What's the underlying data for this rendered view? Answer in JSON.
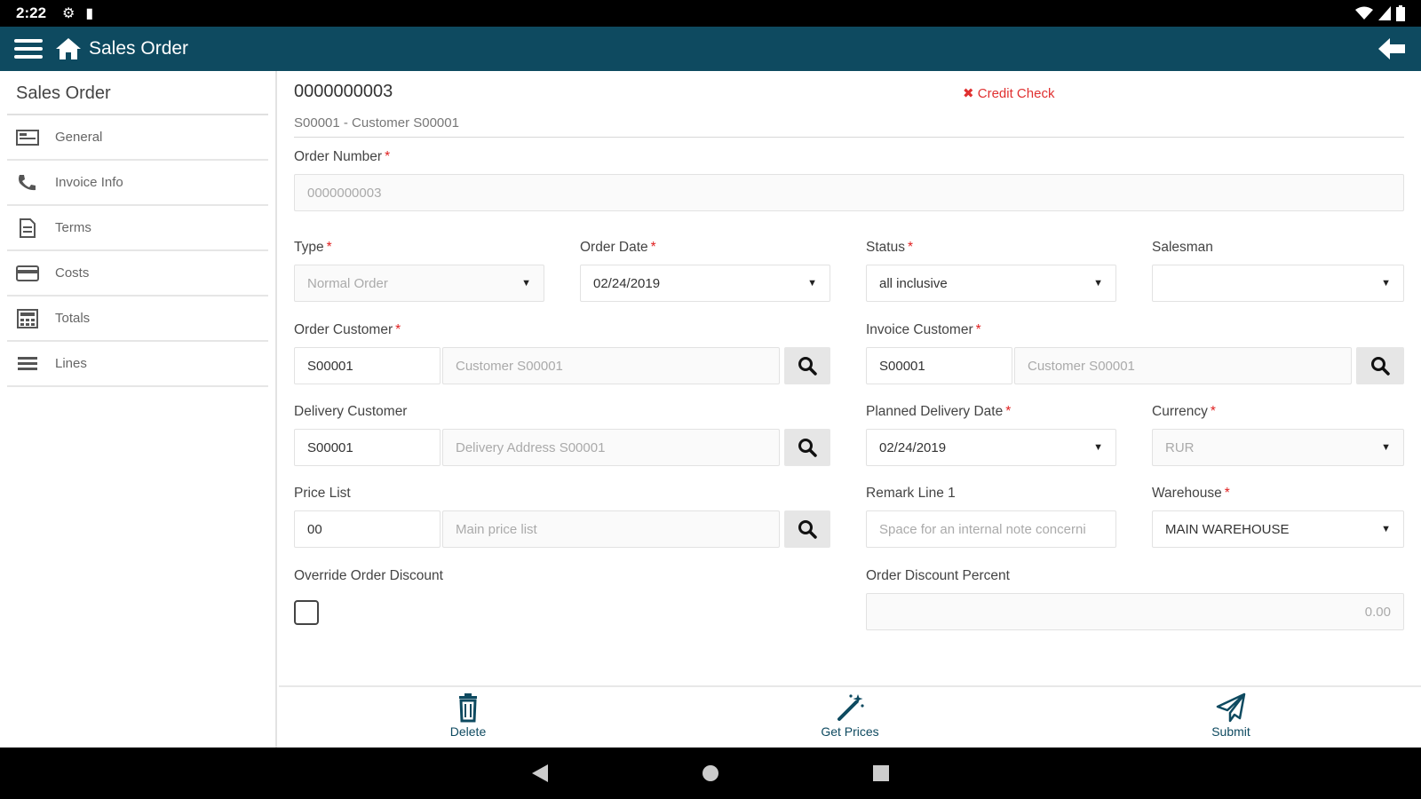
{
  "status_bar": {
    "time": "2:22"
  },
  "app_bar": {
    "title": "Sales Order"
  },
  "sidebar": {
    "title": "Sales Order",
    "items": [
      {
        "label": "General",
        "icon": "card-icon"
      },
      {
        "label": "Invoice Info",
        "icon": "phone-icon"
      },
      {
        "label": "Terms",
        "icon": "document-icon"
      },
      {
        "label": "Costs",
        "icon": "credit-card-icon"
      },
      {
        "label": "Totals",
        "icon": "calculator-icon"
      },
      {
        "label": "Lines",
        "icon": "list-icon"
      }
    ]
  },
  "header": {
    "order_id": "0000000003",
    "credit_check": "Credit Check",
    "customer_line": "S00001 - Customer S00001"
  },
  "form": {
    "order_number": {
      "label": "Order Number",
      "value": "0000000003"
    },
    "type": {
      "label": "Type",
      "value": "Normal Order"
    },
    "order_date": {
      "label": "Order Date",
      "value": "02/24/2019"
    },
    "status": {
      "label": "Status",
      "value": "all inclusive"
    },
    "salesman": {
      "label": "Salesman",
      "value": ""
    },
    "order_customer": {
      "label": "Order Customer",
      "code": "S00001",
      "name": "Customer S00001"
    },
    "invoice_customer": {
      "label": "Invoice Customer",
      "code": "S00001",
      "name": "Customer S00001"
    },
    "delivery_customer": {
      "label": "Delivery Customer",
      "code": "S00001",
      "name": "Delivery Address S00001"
    },
    "planned_delivery_date": {
      "label": "Planned Delivery Date",
      "value": "02/24/2019"
    },
    "currency": {
      "label": "Currency",
      "value": "RUR"
    },
    "price_list": {
      "label": "Price List",
      "code": "00",
      "name": "Main price list"
    },
    "remark_line_1": {
      "label": "Remark Line 1",
      "placeholder": "Space for an internal note concerni"
    },
    "warehouse": {
      "label": "Warehouse",
      "value": "MAIN WAREHOUSE"
    },
    "override_order_discount": {
      "label": "Override Order Discount",
      "checked": false
    },
    "order_discount_percent": {
      "label": "Order Discount Percent",
      "value": "0.00"
    }
  },
  "actions": {
    "delete": "Delete",
    "get_prices": "Get Prices",
    "submit": "Submit"
  },
  "colors": {
    "primary": "#0e4a60",
    "required": "#e02020"
  }
}
